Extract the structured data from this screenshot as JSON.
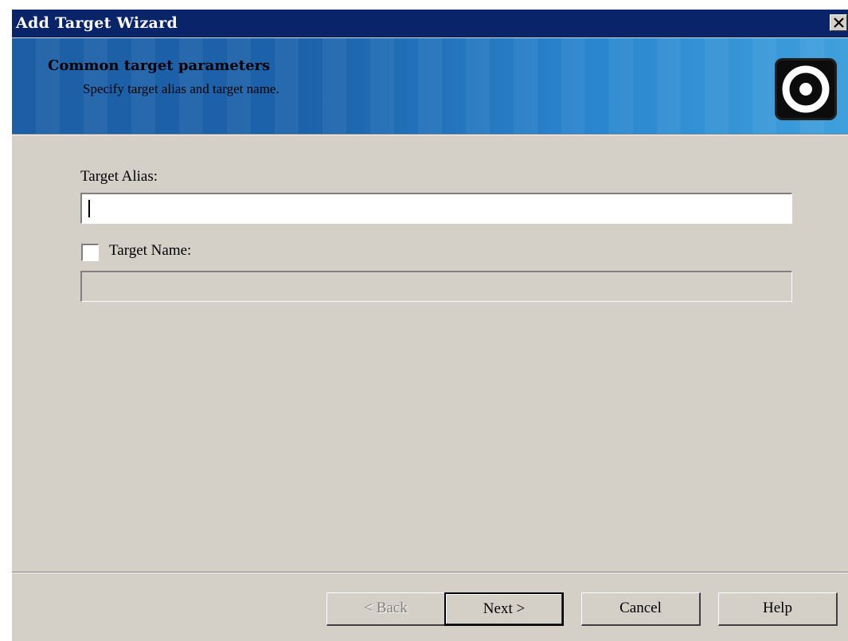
{
  "window": {
    "title": "Add Target Wizard",
    "close_icon": "close-icon"
  },
  "banner": {
    "title": "Common target parameters",
    "subtitle": "Specify target alias and target name.",
    "logo_icon": "target-ring-icon",
    "gradient_start": "#1d5fa6",
    "gradient_end": "#3fa0dc"
  },
  "form": {
    "alias_label": "Target Alias:",
    "alias_value": "",
    "name_checkbox_label": "Target Name:",
    "name_checkbox_checked": false,
    "name_value": "",
    "name_enabled": false
  },
  "buttons": {
    "back_label": "< Back",
    "back_enabled": false,
    "next_label": "Next >",
    "cancel_label": "Cancel",
    "help_label": "Help"
  },
  "colors": {
    "title_bar": "#0a246a",
    "dialog_face": "#d4d0c8"
  }
}
